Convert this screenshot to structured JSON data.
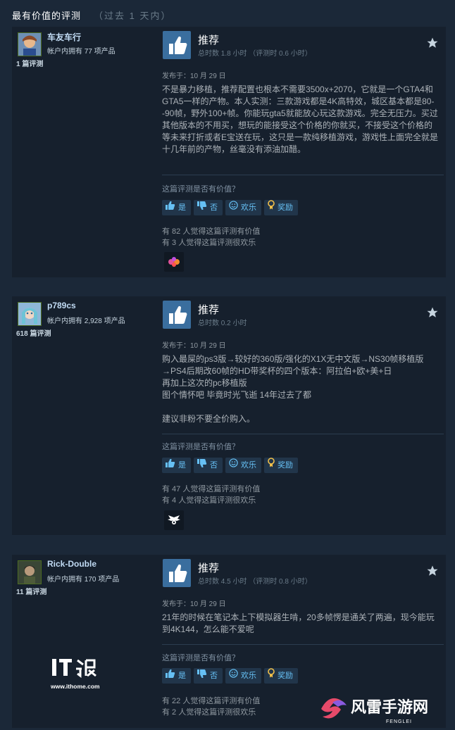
{
  "header": {
    "title": "最有价值的评测",
    "subtitle": "（过去 1 天内）"
  },
  "reviews": [
    {
      "author_name": "车友车行",
      "products": "帐户内拥有 77 项产品",
      "review_count": "1 篇评测",
      "verdict": "推荐",
      "hours": "总时数 1.8 小时    （评测时 0.6 小时）",
      "posted": "发布于：10 月 29 日",
      "text": "不是暴力移植，推荐配置也根本不需要3500x+2070，它就是一个GTA4和GTA5一样的产物。本人实测：三款游戏都是4K高特效，城区基本都是80--90帧，野外100+帧。你能玩gta5就能放心玩这款游戏。完全无压力。买过其他版本的不用买，想玩的能接受这个价格的你就买，不接受这个价格的 等未来打折或者E宝送在玩，这只是一款纯移植游戏，游戏性上面完全就是十几年前的产物，丝毫没有添油加醋。",
      "helpful_question": "这篇评测是否有价值？",
      "btn_yes": "是",
      "btn_no": "否",
      "btn_funny": "欢乐",
      "btn_award": "奖励",
      "helpful_count": "有 82 人觉得这篇评测有价值",
      "funny_count": "有 3 人觉得这篇评测很欢乐",
      "award_icon": "award-badge-icon"
    },
    {
      "author_name": "p789cs",
      "products": "帐户内拥有 2,928 项产品",
      "review_count": "618 篇评测",
      "verdict": "推荐",
      "hours": "总时数 0.2 小时",
      "posted": "发布于：10 月 29 日",
      "text": "购入最屎的ps3版→较好的360版/强化的X1X无中文版→NS30帧移植版→PS4后期改60帧的HD带奖杯的四个版本：阿拉伯+欧+美+日\n再加上这次的pc移植版\n图个情怀吧 毕竟时光飞逝 14年过去了都\n\n建议非粉不要全价购入。",
      "helpful_question": "这篇评测是否有价值？",
      "btn_yes": "是",
      "btn_no": "否",
      "btn_funny": "欢乐",
      "btn_award": "奖励",
      "helpful_count": "有 47 人觉得这篇评测有价值",
      "funny_count": "有 4 人觉得这篇评测很欢乐",
      "award_icon": "award-wings-icon"
    },
    {
      "author_name": "Rick-Double",
      "products": "帐户内拥有 170 项产品",
      "review_count": "11 篇评测",
      "verdict": "推荐",
      "hours": "总时数 4.5 小时    （评测时 0.8 小时）",
      "posted": "发布于：10 月 29 日",
      "text": "21年的时候在笔记本上下模拟器生啃，20多帧愣是通关了两遍，现今能玩到4K144，怎么能不爱呢",
      "helpful_question": "这篇评测是否有价值？",
      "btn_yes": "是",
      "btn_no": "否",
      "btn_funny": "欢乐",
      "btn_award": "奖励",
      "helpful_count": "有 22 人觉得这篇评测有价值",
      "funny_count": "有 2 人觉得这篇评测很欢乐"
    }
  ],
  "watermark": {
    "it_url": "www.ithome.com",
    "fl_name": "风雷手游网",
    "fl_sub": "FENGLEI"
  }
}
